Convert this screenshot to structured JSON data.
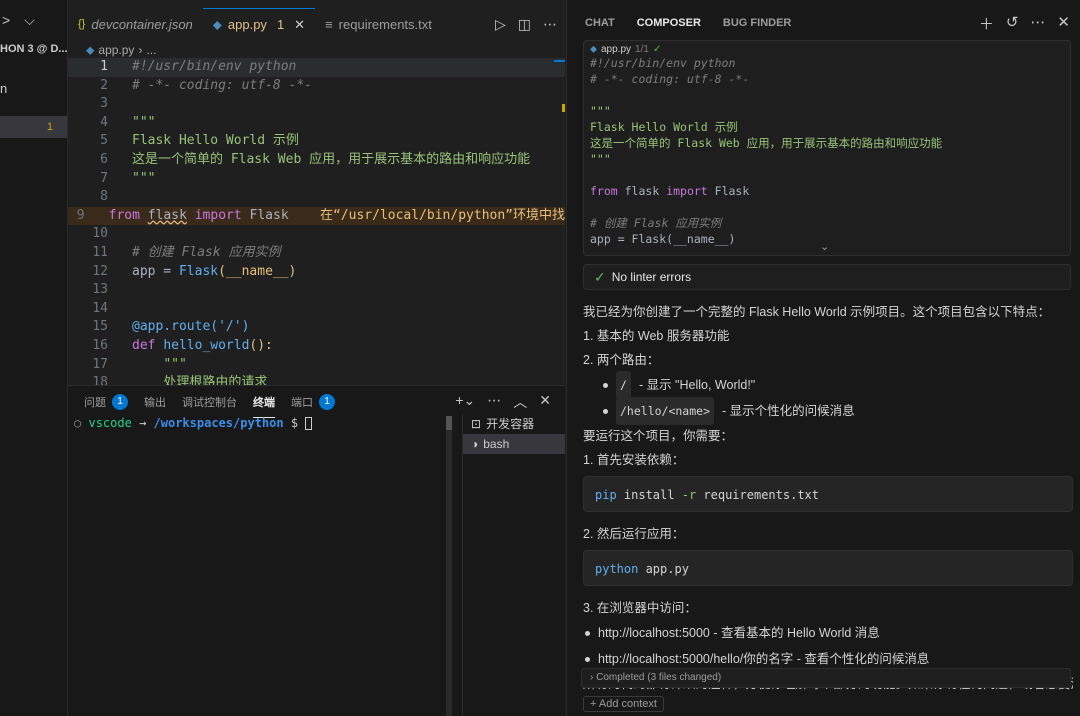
{
  "sidebar": {
    "section_title": "HON 3 @ D...",
    "item_n": "n",
    "selected_badge": "1"
  },
  "editor": {
    "tabs": [
      {
        "label": "devcontainer.json",
        "icon": "{}"
      },
      {
        "label": "app.py",
        "badge": "1"
      },
      {
        "label": "requirements.txt"
      }
    ],
    "breadcrumb": {
      "file": "app.py",
      "rest": "..."
    },
    "lines": [
      {
        "n": "1"
      },
      {
        "n": "2"
      },
      {
        "n": "3"
      },
      {
        "n": "4"
      },
      {
        "n": "5"
      },
      {
        "n": "6"
      },
      {
        "n": "7"
      },
      {
        "n": "8"
      },
      {
        "n": "9"
      },
      {
        "n": "10"
      },
      {
        "n": "11"
      },
      {
        "n": "12"
      },
      {
        "n": "13"
      },
      {
        "n": "14"
      },
      {
        "n": "15"
      },
      {
        "n": "16"
      },
      {
        "n": "17"
      },
      {
        "n": "18"
      }
    ],
    "code": {
      "l1": "#!/usr/bin/env python",
      "l2": "# -*- coding: utf-8 -*-",
      "l4": "\"\"\"",
      "l5": "Flask Hello World 示例",
      "l6": "这是一个简单的 Flask Web 应用，用于展示基本的路由和响应功能",
      "l7": "\"\"\"",
      "l9_from": "from",
      "l9_mod": "flask",
      "l9_import": "import",
      "l9_name": "Flask",
      "l9_warn": "在“/usr/local/bin/python”环境中找",
      "l11": "# 创建 Flask 应用实例",
      "l12_a": "app",
      "l12_b": " = ",
      "l12_c": "Flask",
      "l12_d": "(__name__)",
      "l15": "@app.route('/')",
      "l16_def": "def",
      "l16_fn": "hello_world",
      "l16_rest": "():",
      "l17": "\"\"\"",
      "l18": "处理根路由的请求"
    }
  },
  "panel": {
    "tabs": [
      {
        "label": "问题",
        "badge": "1"
      },
      {
        "label": "输出"
      },
      {
        "label": "调试控制台"
      },
      {
        "label": "终端"
      },
      {
        "label": "端口",
        "badge": "1"
      }
    ],
    "terminal": {
      "user": "vscode",
      "arrow": "→",
      "path": "/workspaces/python",
      "prompt": "$"
    },
    "terminal_list": [
      {
        "label": "开发容器"
      },
      {
        "label": "bash"
      }
    ]
  },
  "composer": {
    "tabs": [
      "CHAT",
      "COMPOSER",
      "BUG FINDER"
    ],
    "card_file": "app.py",
    "card_count": "1/1",
    "card_code": {
      "k1": "#!/usr/bin/env python",
      "k2": "# -*- coding: utf-8 -*-",
      "k4": "\"\"\"",
      "k5": "Flask Hello World 示例",
      "k6": "这是一个简单的 Flask Web 应用，用于展示基本的路由和响应功能",
      "k7": "\"\"\"",
      "k9_from": "from",
      "k9_mod": " flask ",
      "k9_import": "import",
      "k9_name": " Flask",
      "k11": "# 创建 Flask 应用实例",
      "k12": "app = Flask(__name__)"
    },
    "lint": "No linter errors",
    "msg": {
      "intro": "我已经为你创建了一个完整的 Flask Hello World 示例项目。这个项目包含以下特点：",
      "f1": "1. 基本的 Web 服务器功能",
      "f2": "2. 两个路由：",
      "r1_code": "/",
      "r1_text": "- 显示 \"Hello, World!\"",
      "r2_code": "/hello/<name>",
      "r2_text": "- 显示个性化的问候消息",
      "run": "要运行这个项目，你需要：",
      "s1": "1. 首先安装依赖：",
      "cmd1_a": "pip",
      "cmd1_b": " install ",
      "cmd1_c": "-r",
      "cmd1_d": " requirements.txt",
      "s2": "2. 然后运行应用：",
      "cmd2_a": "python",
      "cmd2_b": " app.py",
      "s3": "3. 在浏览器中访问：",
      "u1": "http://localhost:5000 - 查看基本的 Hello World 消息",
      "u2": "http://localhost:5000/hello/你的名字 - 查看个性化的问候消息",
      "tail": "所有的代码都有详细的注释，方便你理解每个部分的功能。如果你有任何问题，或者想要添加新"
    },
    "completed": "Completed (3 files changed)",
    "add_context": "+ Add context"
  }
}
